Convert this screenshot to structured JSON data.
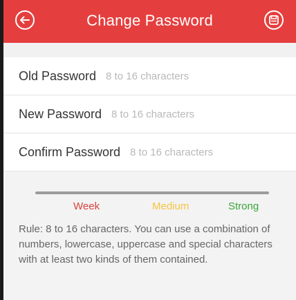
{
  "header": {
    "title": "Change Password",
    "back_icon": "back-circle-icon",
    "save_icon": "save-icon",
    "accent": "#e43f3e"
  },
  "form": {
    "old_password": {
      "label": "Old Password",
      "placeholder": "8 to 16 characters"
    },
    "new_password": {
      "label": "New Password",
      "placeholder": "8 to 16 characters"
    },
    "confirm_password": {
      "label": "Confirm Password",
      "placeholder": "8 to 16 characters"
    }
  },
  "strength": {
    "levels": [
      "Week",
      "Medium",
      "Strong"
    ],
    "colors": [
      "#d9423d",
      "#f5c443",
      "#3aa53a"
    ],
    "rule": "Rule: 8 to 16 characters. You can use a combination of numbers, lowercase, uppercase and special characters with at least two kinds of them contained."
  }
}
